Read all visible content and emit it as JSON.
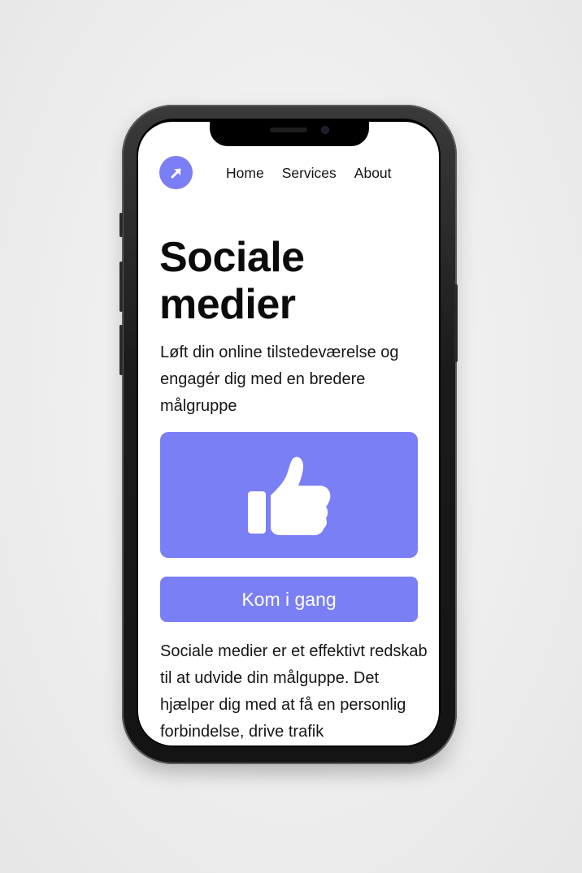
{
  "nav": {
    "logo_icon": "arrow-up-right-icon",
    "links": [
      "Home",
      "Services",
      "About"
    ]
  },
  "hero": {
    "title": "Sociale medier",
    "subtitle": "Løft din online tilstedeværelse og engagér dig med en bredere målgruppe",
    "image_icon": "thumbs-up-icon"
  },
  "cta": {
    "label": "Kom i gang"
  },
  "body": {
    "text": "Sociale medier er et effektivt redskab til at udvide din målguppe. Det hjælper dig med at få en personlig forbindelse, drive trafik"
  },
  "colors": {
    "accent": "#7a7ff5",
    "text": "#141414",
    "background": "#ffffff"
  }
}
